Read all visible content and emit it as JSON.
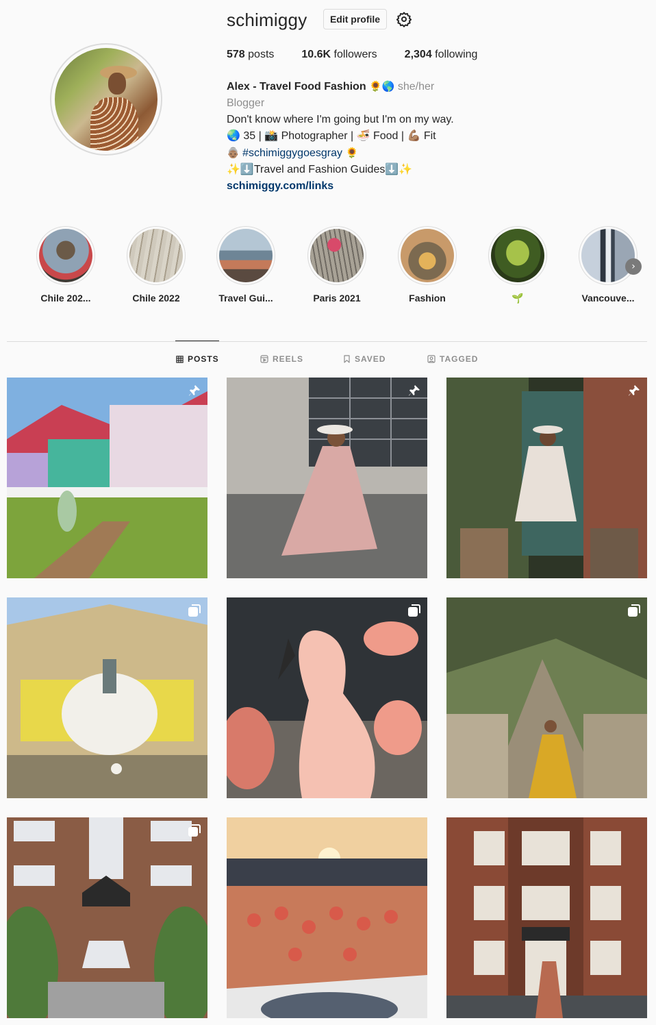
{
  "profile": {
    "username": "schimiggy",
    "edit_label": "Edit profile",
    "stats": {
      "posts_count": "578",
      "posts_label": " posts",
      "followers_count": "10.6K",
      "followers_label": " followers",
      "following_count": "2,304",
      "following_label": " following"
    },
    "bio": {
      "name": "Alex - Travel Food Fashion",
      "name_emoji": "🌻🌎",
      "pronouns": "she/her",
      "category": "Blogger",
      "line1": "Don't know where I'm going but I'm on my way.",
      "line2": "🌏 35 | 📸 Photographer | 🍜 Food | 💪🏽 Fit",
      "line3_emoji": "👵🏽",
      "line3_hashtag": "#schimiggygoesgray",
      "line3_emoji2": "🌻",
      "line4": "✨⬇️Travel and Fashion Guides⬇️✨",
      "link": "schimiggy.com/links"
    }
  },
  "highlights": [
    {
      "label": "Chile 202...",
      "color": "#5a4a3a"
    },
    {
      "label": "Chile 2022",
      "color": "#c9c4b8"
    },
    {
      "label": "Travel Gui...",
      "color": "#7c8fa0"
    },
    {
      "label": "Paris 2021",
      "color": "#9a948a"
    },
    {
      "label": "Fashion",
      "color": "#b08a5a"
    },
    {
      "label": "🌱",
      "color": "#5e7a2e"
    },
    {
      "label": "Vancouve...",
      "color": "#8a95a6"
    }
  ],
  "tabs": [
    {
      "label": "POSTS",
      "icon": "grid-icon",
      "active": true
    },
    {
      "label": "REELS",
      "icon": "reels-icon",
      "active": false
    },
    {
      "label": "SAVED",
      "icon": "bookmark-icon",
      "active": false
    },
    {
      "label": "TAGGED",
      "icon": "tagged-icon",
      "active": false
    }
  ],
  "posts": [
    {
      "badge": "pin-icon",
      "palette": [
        "#7fb0e0",
        "#c93f53",
        "#46b59c",
        "#e8d9e3",
        "#7da43c"
      ]
    },
    {
      "badge": "pin-icon",
      "palette": [
        "#b9b6b0",
        "#3a3f44",
        "#d9a9a5",
        "#6d6d6b",
        "#ece8e2"
      ]
    },
    {
      "badge": "pin-icon",
      "palette": [
        "#4a5a3a",
        "#3e6660",
        "#e8e0d8",
        "#8a6f55",
        "#2d3526"
      ]
    },
    {
      "badge": "carousel-icon",
      "palette": [
        "#a8c7e8",
        "#cdb98a",
        "#e8d84a",
        "#f2f0ea",
        "#8a8066"
      ]
    },
    {
      "badge": "carousel-icon",
      "palette": [
        "#2f3337",
        "#ef9b8a",
        "#f5c1b2",
        "#6b6660",
        "#d87a6a"
      ]
    },
    {
      "badge": "carousel-icon",
      "palette": [
        "#6e7f52",
        "#9a8e78",
        "#d9a826",
        "#4c5a3a",
        "#b8ac94"
      ]
    },
    {
      "badge": "carousel-icon",
      "palette": [
        "#8a5c45",
        "#4f7a3a",
        "#2a2a2a",
        "#e6e8ec",
        "#a07055"
      ]
    },
    {
      "badge": "none",
      "palette": [
        "#e8b46a",
        "#3a3f4a",
        "#d85a4a",
        "#f0d0a0",
        "#556070"
      ]
    },
    {
      "badge": "none",
      "palette": [
        "#8a4a36",
        "#6d3a2a",
        "#e8e2d8",
        "#4a4e52",
        "#b86a50"
      ]
    }
  ]
}
